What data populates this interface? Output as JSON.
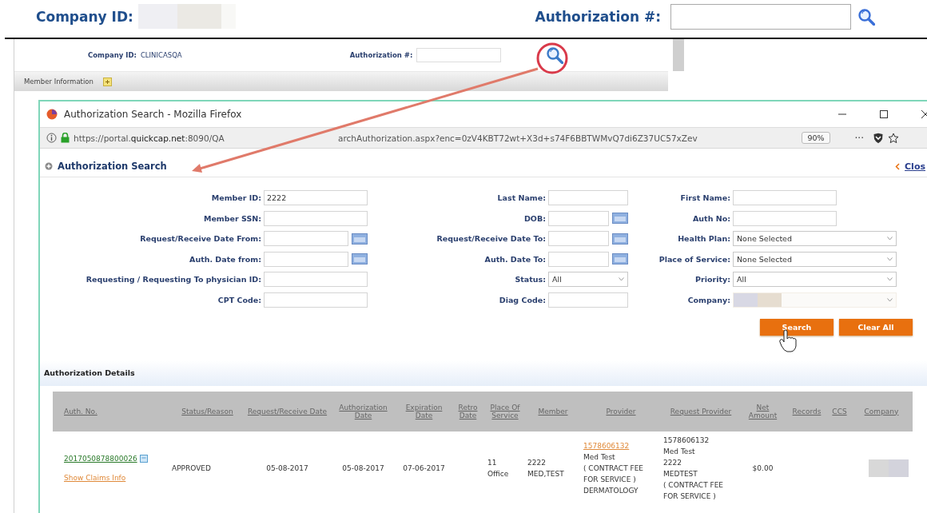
{
  "header": {
    "company_label": "Company ID:",
    "auth_label": "Authorization #:"
  },
  "background_app": {
    "company_label": "Company ID:",
    "company_value": "CLINICASQA",
    "auth_label": "Authorization #:",
    "section_title": "Member Information"
  },
  "popup": {
    "title": "Authorization Search - Mozilla Firefox",
    "url_start": "https://portal.**quickcap.net**:8090/QA",
    "url_end": "archAuthorization.aspx?enc=0zV4KBT72wt+X3d+s74F6BBTWMvQ7di6Z37UC57xZev",
    "zoom": "90%",
    "more": "···"
  },
  "search_panel": {
    "title": "Authorization Search",
    "close": "Clos",
    "fields": [
      {
        "label": "Member ID:",
        "kind": "text",
        "value": "2222"
      },
      {
        "label": "Last Name:",
        "kind": "text"
      },
      {
        "label": "First Name:",
        "kind": "text"
      },
      {
        "label": "Member SSN:",
        "kind": "text"
      },
      {
        "label": "DOB:",
        "kind": "date"
      },
      {
        "label": "Auth No:",
        "kind": "text"
      },
      {
        "label": "Request/Receive Date From:",
        "kind": "date"
      },
      {
        "label": "Request/Receive Date To:",
        "kind": "date"
      },
      {
        "label": "Health Plan:",
        "kind": "select",
        "value": "None Selected"
      },
      {
        "label": "Auth. Date from:",
        "kind": "date"
      },
      {
        "label": "Auth. Date To:",
        "kind": "date"
      },
      {
        "label": "Place of Service:",
        "kind": "select",
        "value": "None Selected"
      },
      {
        "label": "Requesting / Requesting To physician ID:",
        "kind": "text"
      },
      {
        "label": "Status:",
        "kind": "select",
        "value": "All"
      },
      {
        "label": "Priority:",
        "kind": "select",
        "value": "All"
      },
      {
        "label": "CPT Code:",
        "kind": "text"
      },
      {
        "label": "Diag Code:",
        "kind": "text"
      },
      {
        "label": "Company:",
        "kind": "redacted"
      }
    ],
    "buttons": [
      "Search",
      "Clear All"
    ]
  },
  "details": {
    "title": "Authorization Details",
    "columns": [
      "Auth. No.",
      "Status/Reason",
      "Request/Receive Date",
      "Authorization Date",
      "Expiration Date",
      "Retro Date",
      "Place Of Service",
      "Member",
      "Provider",
      "Request Provider",
      "Net Amount",
      "Records",
      "CCS",
      "Company"
    ],
    "rows": [
      {
        "cells": [
          {
            "lines": [
              {
                "text": "2017050878800026",
                "kind": "id_link"
              },
              {
                "text": "Show Claims Info",
                "kind": "info_link"
              }
            ]
          },
          {
            "lines": [
              {
                "text": "APPROVED",
                "kind": "text"
              }
            ]
          },
          {
            "lines": [
              {
                "text": "05-08-2017",
                "kind": "text"
              }
            ]
          },
          {
            "lines": [
              {
                "text": "05-08-2017",
                "kind": "text"
              }
            ]
          },
          {
            "lines": [
              {
                "text": "07-06-2017",
                "kind": "text"
              }
            ]
          },
          {},
          {
            "lines": [
              {
                "text": "11",
                "kind": "text"
              },
              {
                "text": "Office",
                "kind": "text"
              }
            ]
          },
          {
            "lines": [
              {
                "text": "2222",
                "kind": "text"
              },
              {
                "text": "MED,TEST",
                "kind": "text"
              }
            ]
          },
          {
            "lines": [
              {
                "text": "1578606132",
                "kind": "info_link"
              },
              {
                "text": "Med Test",
                "kind": "text"
              },
              {
                "text": "( CONTRACT FEE FOR SERVICE )",
                "kind": "text"
              },
              {
                "text": "DERMATOLOGY",
                "kind": "text"
              }
            ]
          },
          {
            "lines": [
              {
                "text": "1578606132",
                "kind": "text"
              },
              {
                "text": "Med Test",
                "kind": "text"
              },
              {
                "text": "2222",
                "kind": "text"
              },
              {
                "text": "MEDTEST",
                "kind": "text"
              },
              {
                "text": "( CONTRACT FEE FOR SERVICE )",
                "kind": "text"
              }
            ]
          },
          {
            "lines": [
              {
                "text": "$0.00",
                "kind": "text"
              }
            ]
          },
          {},
          {},
          {
            "lines": [
              {
                "kind": "redacted"
              }
            ]
          }
        ]
      }
    ]
  }
}
